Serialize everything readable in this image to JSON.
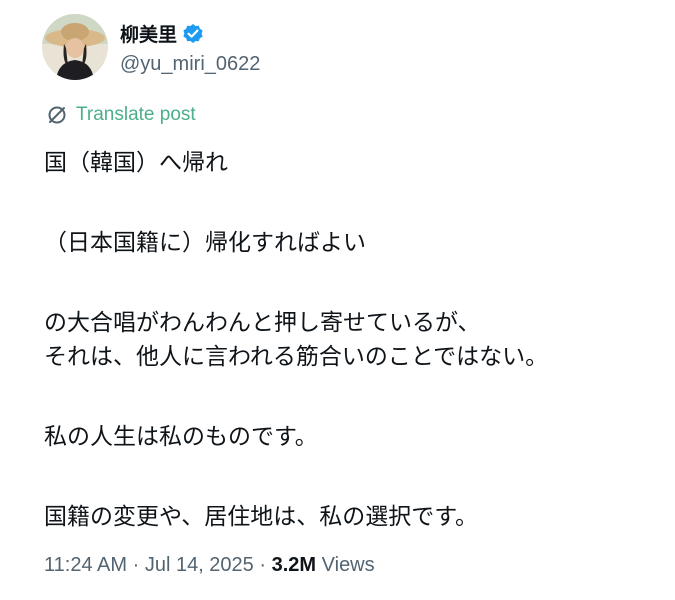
{
  "author": {
    "display_name": "柳美里",
    "handle": "@yu_miri_0622",
    "verified": true,
    "verified_color": "#1d9bf0"
  },
  "translate": {
    "label": "Translate post",
    "icon": "translate-icon",
    "color": "#4caf89"
  },
  "post": {
    "lines": [
      "国（韓国）へ帰れ",
      "（日本国籍に）帰化すればよい",
      "の大合唱がわんわんと押し寄せているが、",
      "それは、他人に言われる筋合いのことではない。",
      "私の人生は私のものです。",
      "国籍の変更や、居住地は、私の選択です。"
    ]
  },
  "meta": {
    "time": "11:24 AM",
    "separator": "·",
    "date": "Jul 14, 2025",
    "views_count": "3.2M",
    "views_label": "Views"
  }
}
